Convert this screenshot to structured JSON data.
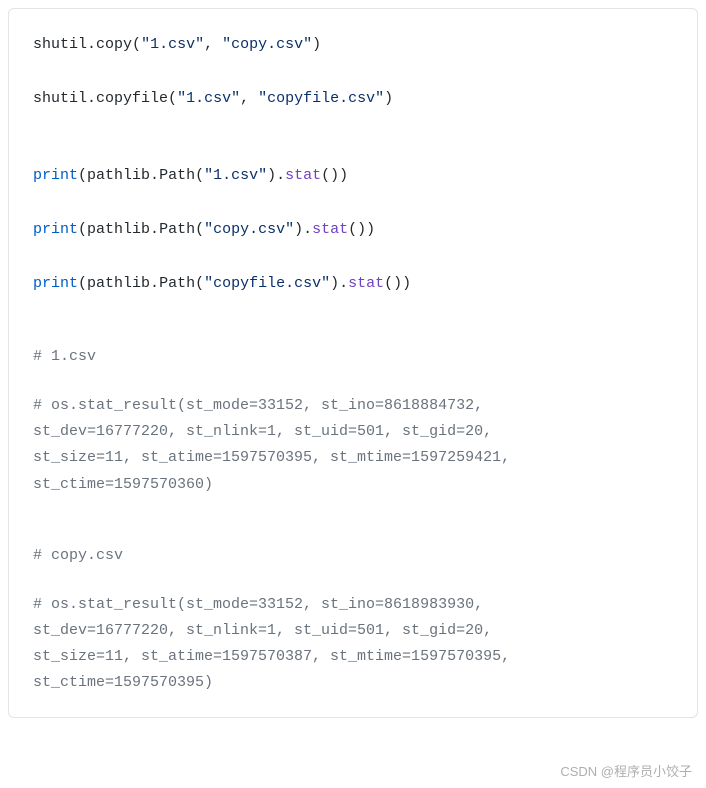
{
  "code": {
    "l1": {
      "fn": "shutil",
      "method": "copy",
      "s1": "\"1.csv\"",
      "s2": "\"copy.csv\""
    },
    "l2": {
      "fn": "shutil",
      "method": "copyfile",
      "s1": "\"1.csv\"",
      "s2": "\"copyfile.csv\""
    },
    "l3": {
      "fn": "print",
      "mod": "pathlib",
      "cls": "Path",
      "s1": "\"1.csv\"",
      "method": "stat"
    },
    "l4": {
      "fn": "print",
      "mod": "pathlib",
      "cls": "Path",
      "s1": "\"copy.csv\"",
      "method": "stat"
    },
    "l5": {
      "fn": "print",
      "mod": "pathlib",
      "cls": "Path",
      "s1": "\"copyfile.csv\"",
      "method": "stat"
    },
    "c1_header": "# 1.csv",
    "c1_l1": "# os.stat_result(st_mode=33152, st_ino=8618884732, ",
    "c1_l2": "st_dev=16777220, st_nlink=1, st_uid=501, st_gid=20, ",
    "c1_l3": "st_size=11, st_atime=1597570395, st_mtime=1597259421, ",
    "c1_l4": "st_ctime=1597570360)",
    "c2_header": "# copy.csv",
    "c2_l1": "# os.stat_result(st_mode=33152, st_ino=8618983930, ",
    "c2_l2": "st_dev=16777220, st_nlink=1, st_uid=501, st_gid=20, ",
    "c2_l3": "st_size=11, st_atime=1597570387, st_mtime=1597570395, ",
    "c2_l4": "st_ctime=1597570395)"
  },
  "watermark": "CSDN @程序员小饺子"
}
